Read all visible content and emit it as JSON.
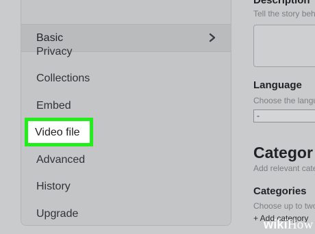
{
  "sidebar": {
    "items": [
      {
        "label": "Basic",
        "active": true
      },
      {
        "label": "Privacy"
      },
      {
        "label": "Collections"
      },
      {
        "label": "Embed"
      },
      {
        "label": "Video file",
        "highlighted": true
      },
      {
        "label": "Advanced"
      },
      {
        "label": "History"
      },
      {
        "label": "Upgrade"
      }
    ],
    "chevron_icon": "chevron-right-icon"
  },
  "right_panel": {
    "description_heading": "Description",
    "description_hint": "Tell the story behi",
    "language_heading": "Language",
    "language_hint": "Choose the langu",
    "language_value": "-",
    "category_heading": "Categor",
    "category_hint": "Add relevant cate",
    "categories_heading": "Categories",
    "categories_hint": "Choose up to two",
    "add_category": "+ Add category"
  },
  "watermark": {
    "wiki": "wiki",
    "how": "How"
  },
  "colors": {
    "highlight": "#22ee1c",
    "background": "#c9cbcc"
  }
}
